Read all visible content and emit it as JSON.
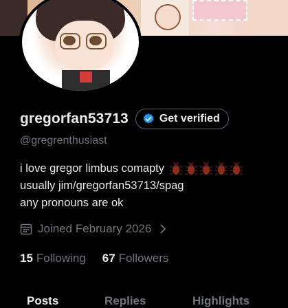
{
  "profile": {
    "display_name": "gregorfan53713",
    "verify_button_label": "Get verified",
    "handle": "@gregrenthusiast",
    "bio_lines": [
      "i love gregor limbus comapty",
      "usually jim/gregorfan53713/spag",
      "any pronouns are ok"
    ],
    "bio_emoji": [
      "cockroach",
      "cockroach",
      "cockroach",
      "cockroach",
      "cockroach"
    ],
    "joined": "Joined February 2026"
  },
  "stats": {
    "following_count": "15",
    "following_label": "Following",
    "followers_count": "67",
    "followers_label": "Followers"
  },
  "tabs": [
    {
      "label": "Posts"
    },
    {
      "label": "Replies"
    },
    {
      "label": "Highlights"
    }
  ],
  "colors": {
    "background": "#000000",
    "text": "#e7e9ea",
    "muted": "#71767b",
    "verified_badge": "#1d9bf0",
    "button_border": "#536471"
  },
  "icons": {
    "verified": "verified-badge-icon",
    "calendar": "calendar-icon",
    "chevron": "chevron-right-icon"
  }
}
